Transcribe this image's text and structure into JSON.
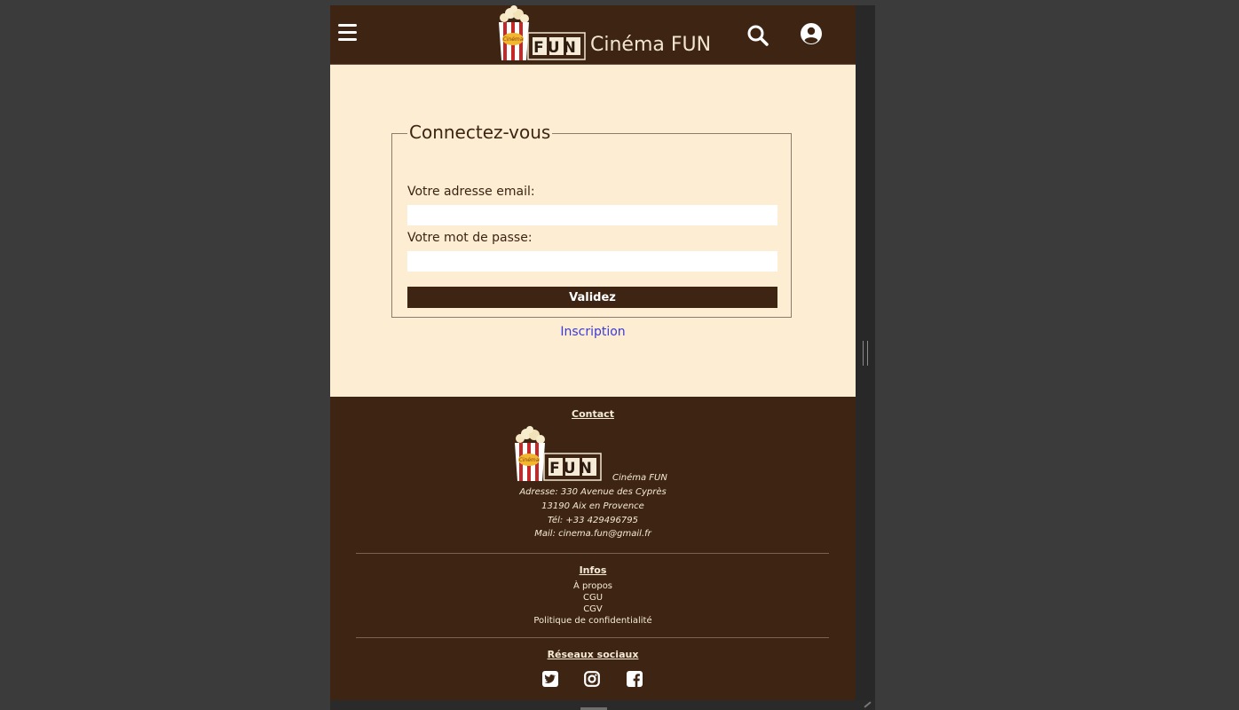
{
  "header": {
    "logo_word": "FUN",
    "logo_badge": "Cinéma",
    "title": "Cinéma FUN"
  },
  "login": {
    "legend": "Connectez-vous",
    "email_label": "Votre adresse email:",
    "password_label": "Votre mot de passe:",
    "email_value": "",
    "password_value": "",
    "submit_label": "Validez",
    "register_link": "Inscription"
  },
  "footer": {
    "contact_heading": "Contact",
    "brand_name": "Cinéma FUN",
    "address_line1": "Adresse:   330 Avenue des Cyprès",
    "address_line2": "13190 Aix en Provence",
    "phone": "Tél: +33  429496795",
    "mail": "Mail:   cinema.fun@gmail.fr",
    "infos_heading": "Infos",
    "info_links": [
      "À propos",
      "CGU",
      "CGV",
      "Politique de confidentialité"
    ],
    "social_heading": "Réseaux sociaux",
    "social_icons": [
      "twitter-icon",
      "instagram-icon",
      "facebook-icon"
    ]
  },
  "colors": {
    "brown": "#3d2413",
    "cream": "#fcedd3",
    "link_blue": "#3b3bd6"
  }
}
